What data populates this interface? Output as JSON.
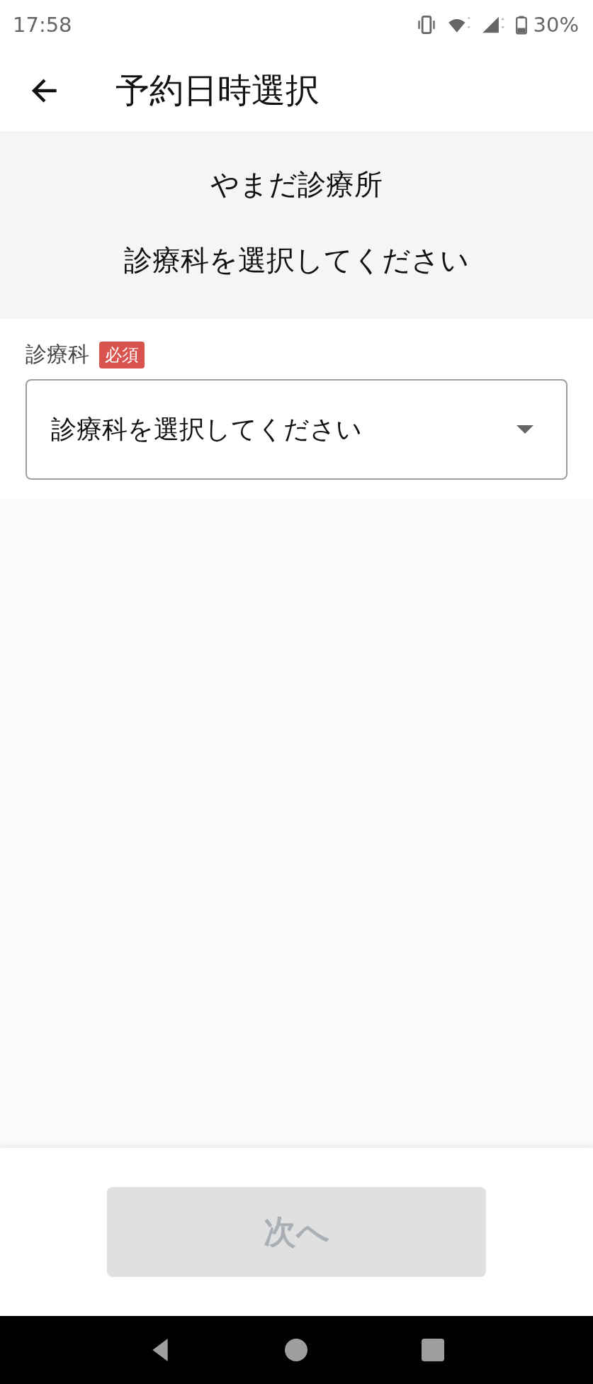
{
  "status_bar": {
    "time": "17:58",
    "battery": "30%"
  },
  "app_bar": {
    "title": "予約日時選択"
  },
  "header": {
    "clinic": "やまだ診療所",
    "instruction": "診療科を選択してください"
  },
  "form": {
    "label": "診療科",
    "required_badge": "必須",
    "select": {
      "placeholder": "診療科を選択してください"
    }
  },
  "next_button": {
    "label": "次へ",
    "disabled": true
  }
}
